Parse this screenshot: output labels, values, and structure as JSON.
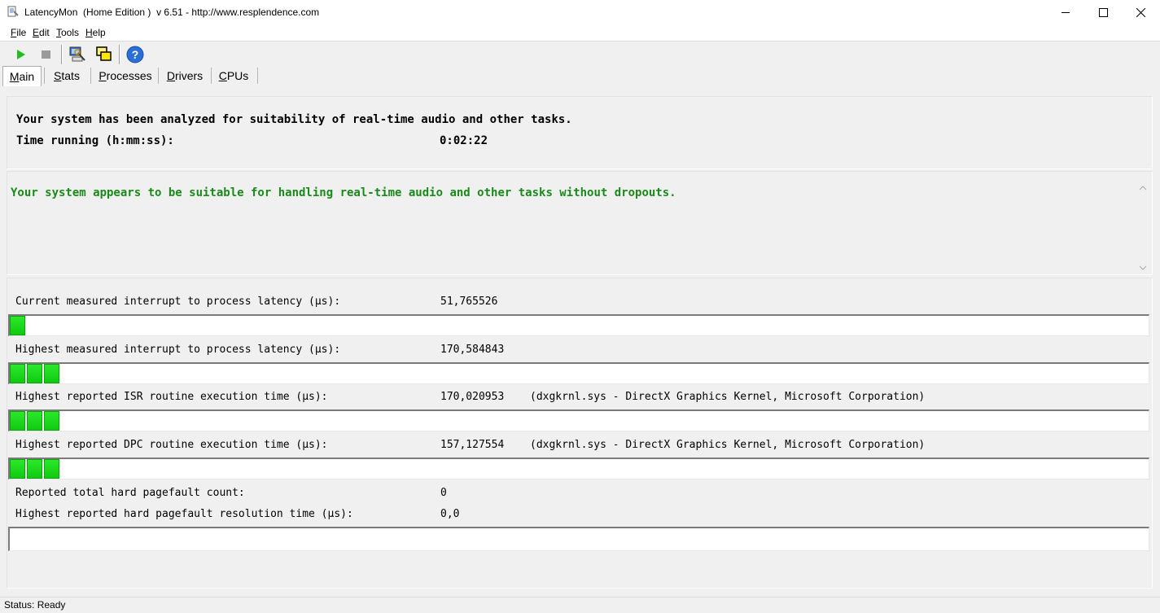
{
  "window": {
    "title": "LatencyMon  (Home Edition )  v 6.51 - http://www.resplendence.com"
  },
  "menu": {
    "items": [
      {
        "key": "F",
        "rest": "ile"
      },
      {
        "key": "E",
        "rest": "dit"
      },
      {
        "key": "T",
        "rest": "ools"
      },
      {
        "key": "H",
        "rest": "elp"
      }
    ]
  },
  "toolbar": {
    "buttons": [
      "play-icon",
      "stop-icon",
      "computer-icon",
      "windows-icon",
      "help-icon"
    ]
  },
  "tabs": [
    {
      "key": "M",
      "rest": "ain"
    },
    {
      "key": "S",
      "rest": "tats"
    },
    {
      "key": "P",
      "rest": "rocesses"
    },
    {
      "key": "D",
      "rest": "rivers"
    },
    {
      "key": "C",
      "rest": "PUs"
    }
  ],
  "summary": {
    "analyzed": "Your system has been analyzed for suitability of real-time audio and other tasks.",
    "time_label": "Time running (h:mm:ss):",
    "time_value": "0:02:22"
  },
  "verdict": {
    "text": "Your system appears to be suitable for handling real-time audio and other tasks without dropouts.",
    "color": "#1a8a1a"
  },
  "metrics": {
    "current_latency": {
      "label": "Current measured interrupt to process latency (µs):",
      "value": "51,765526",
      "bar_fraction": 0.013
    },
    "highest_latency": {
      "label": "Highest measured interrupt to process latency (µs):",
      "value": "170,584843",
      "bar_fraction": 0.044
    },
    "isr": {
      "label": "Highest reported ISR routine execution time (µs):",
      "value": "170,020953",
      "detail": "(dxgkrnl.sys - DirectX Graphics Kernel, Microsoft Corporation)",
      "bar_fraction": 0.046
    },
    "dpc": {
      "label": "Highest reported DPC routine execution time (µs):",
      "value": "157,127554",
      "detail": "(dxgkrnl.sys - DirectX Graphics Kernel, Microsoft Corporation)",
      "bar_fraction": 0.046
    },
    "pagefault_count": {
      "label": "Reported total hard pagefault count:",
      "value": "0"
    },
    "pagefault_time": {
      "label": "Highest reported hard pagefault resolution time (µs):",
      "value": "0,0",
      "bar_fraction": 0
    }
  },
  "status": {
    "text": "Status: Ready"
  },
  "colors": {
    "bar_fill": "#1fd81f",
    "accent_green": "#1a8a1a"
  }
}
